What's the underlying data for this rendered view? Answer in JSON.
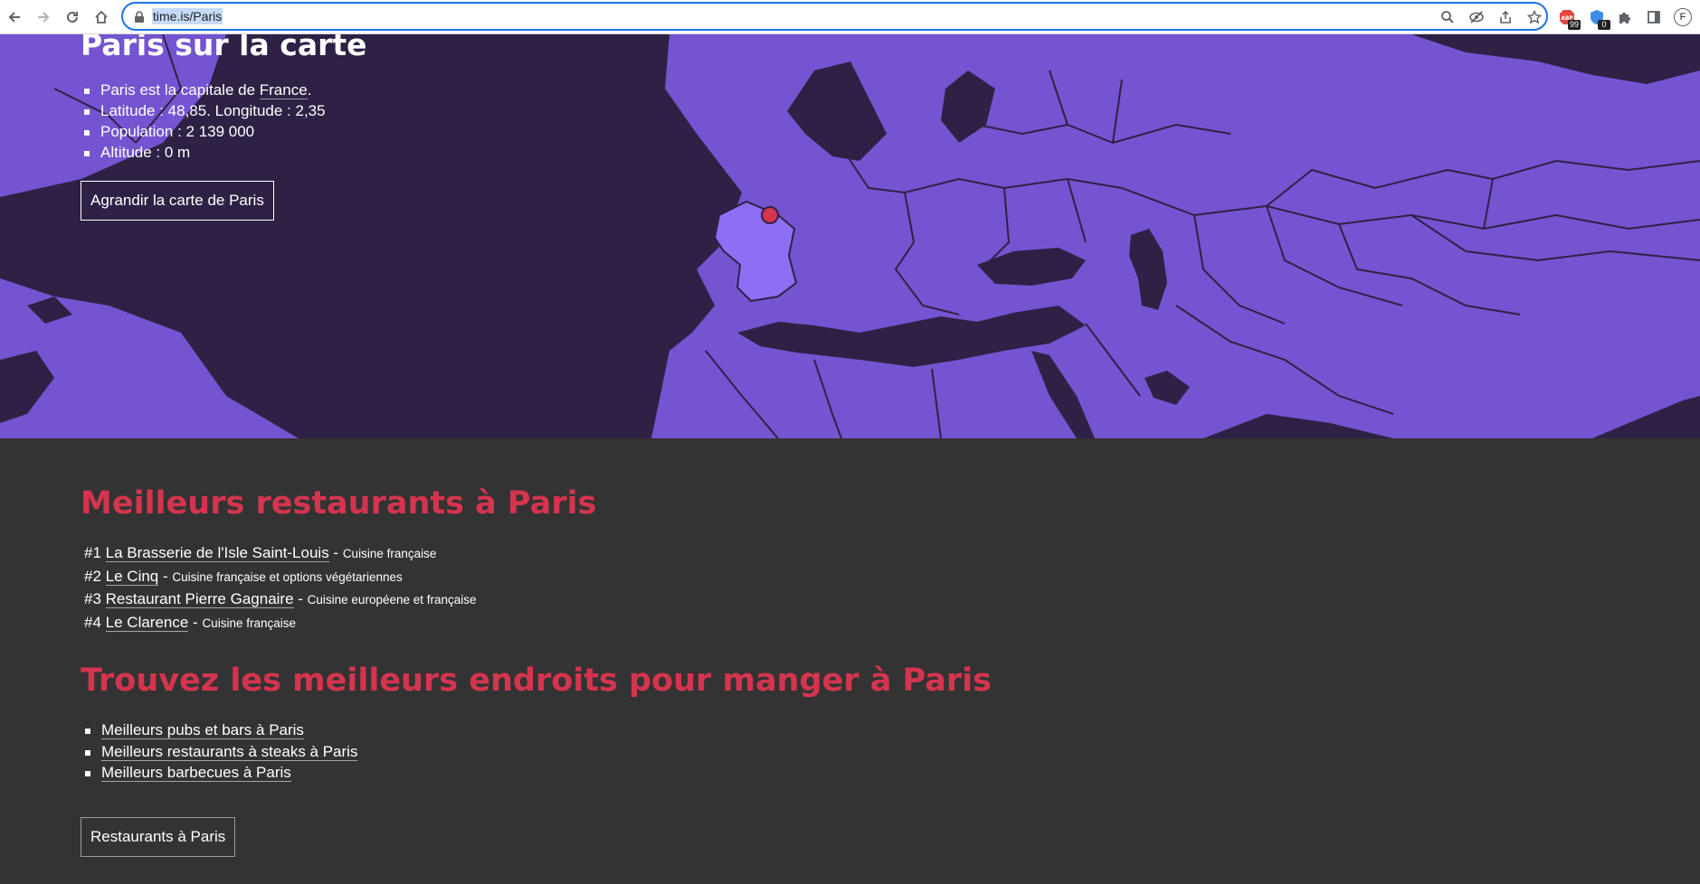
{
  "browser": {
    "url": "time.is/Paris",
    "extensions": [
      {
        "icon": "abp-icon",
        "badge": "99"
      },
      {
        "icon": "shield-extension-icon",
        "badge": "0"
      },
      {
        "icon": "puzzle-icon",
        "badge": ""
      }
    ],
    "profile_initial": "F"
  },
  "hero": {
    "title": "Paris sur la carte",
    "facts": [
      {
        "prefix": "Paris est la capitale de ",
        "link": "France",
        "suffix": "."
      },
      {
        "prefix": "Latitude : 48,85. Longitude : 2,35",
        "link": "",
        "suffix": ""
      },
      {
        "prefix": "Population : 2 139 000",
        "link": "",
        "suffix": ""
      },
      {
        "prefix": "Altitude : 0 m",
        "link": "",
        "suffix": ""
      }
    ],
    "enlarge_button": "Agrandir la carte de Paris",
    "map_colors": {
      "land": "#7454d1",
      "water": "#2f2145",
      "highlight": "#8c6ff5",
      "marker": "#d5344e"
    }
  },
  "restaurants": {
    "title": "Meilleurs restaurants à Paris",
    "items": [
      {
        "rank": "#1",
        "name": "La Brasserie de l'Isle Saint-Louis",
        "sep": " - ",
        "cuisine": "Cuisine française"
      },
      {
        "rank": "#2",
        "name": "Le Cinq",
        "sep": " - ",
        "cuisine": "Cuisine française et options végétariennes"
      },
      {
        "rank": "#3",
        "name": "Restaurant Pierre Gagnaire",
        "sep": " - ",
        "cuisine": "Cuisine européene et française"
      },
      {
        "rank": "#4",
        "name": "Le Clarence",
        "sep": " - ",
        "cuisine": "Cuisine française"
      }
    ]
  },
  "places": {
    "title": "Trouvez les meilleurs endroits pour manger à Paris",
    "links": [
      "Meilleurs pubs et bars à Paris",
      "Meilleurs restaurants à steaks à Paris",
      "Meilleurs barbecues à Paris"
    ],
    "button": "Restaurants à Paris"
  }
}
